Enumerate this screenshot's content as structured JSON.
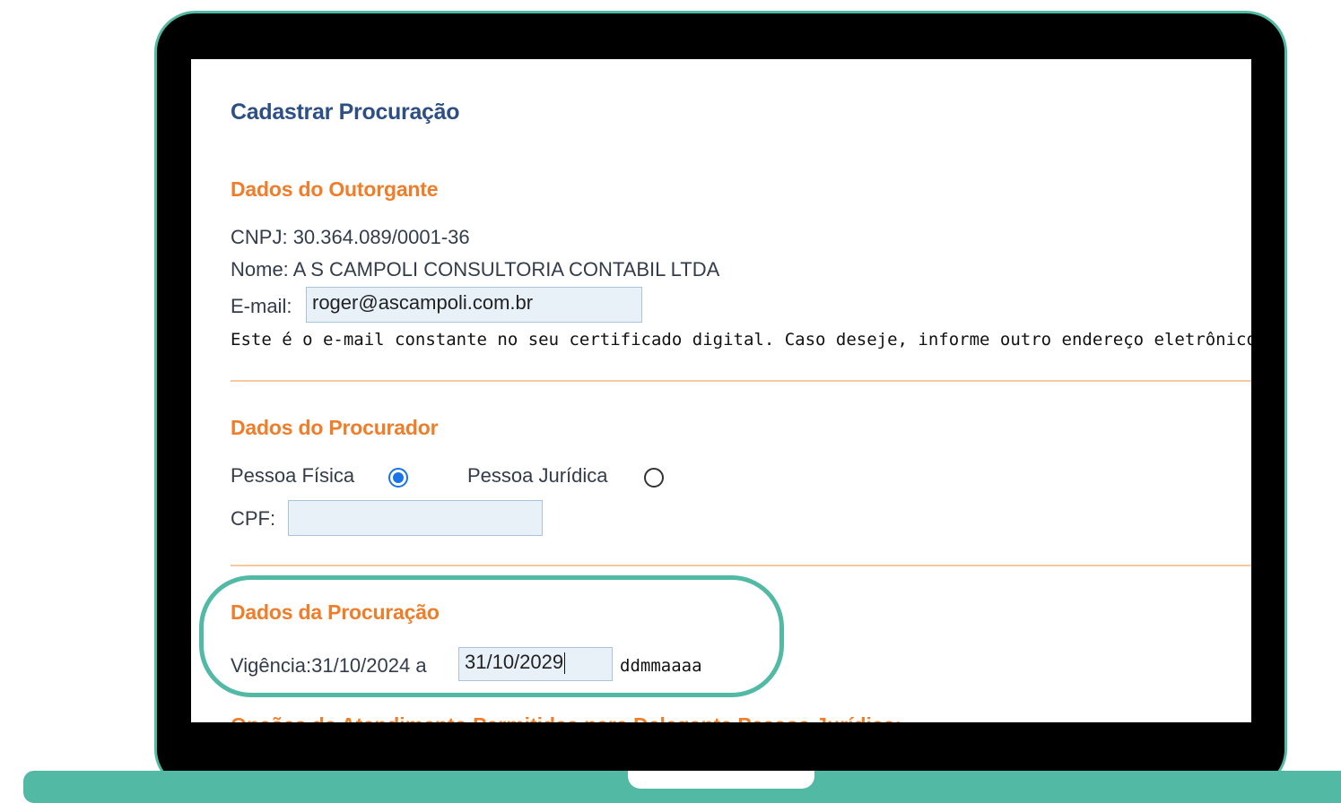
{
  "page": {
    "title": "Cadastrar Procuração"
  },
  "outorgante": {
    "section_title": "Dados do Outorgante",
    "cnpj_label": "CNPJ:",
    "cnpj_value": "30.364.089/0001-36",
    "nome_label": "Nome:",
    "nome_value": "A S CAMPOLI CONSULTORIA CONTABIL LTDA",
    "email_label": "E-mail:",
    "email_value": "roger@ascampoli.com.br",
    "email_note": "Este é o e-mail constante no seu certificado digital. Caso deseje, informe outro endereço eletrônico"
  },
  "procurador": {
    "section_title": "Dados do Procurador",
    "pessoa_fisica_label": "Pessoa Física",
    "pessoa_fisica_selected": true,
    "pessoa_juridica_label": "Pessoa Jurídica",
    "pessoa_juridica_selected": false,
    "cpf_label": "CPF:",
    "cpf_value": ""
  },
  "procuracao": {
    "section_title": "Dados da Procuração",
    "vigencia_label": "Vigência:",
    "vigencia_inicio": "31/10/2024",
    "vigencia_sep": "a",
    "vigencia_fim": "31/10/2029",
    "date_format_hint": "ddmmaaaa"
  },
  "next_section": {
    "title_partial": "Opções de Atendimento Permitidas para Delegante Pessoa Jurídica:"
  },
  "colors": {
    "frame_accent": "#52b9a4",
    "section_title": "#f07d2a",
    "page_title": "#2e4f86",
    "radio_selected": "#1a73e8"
  }
}
